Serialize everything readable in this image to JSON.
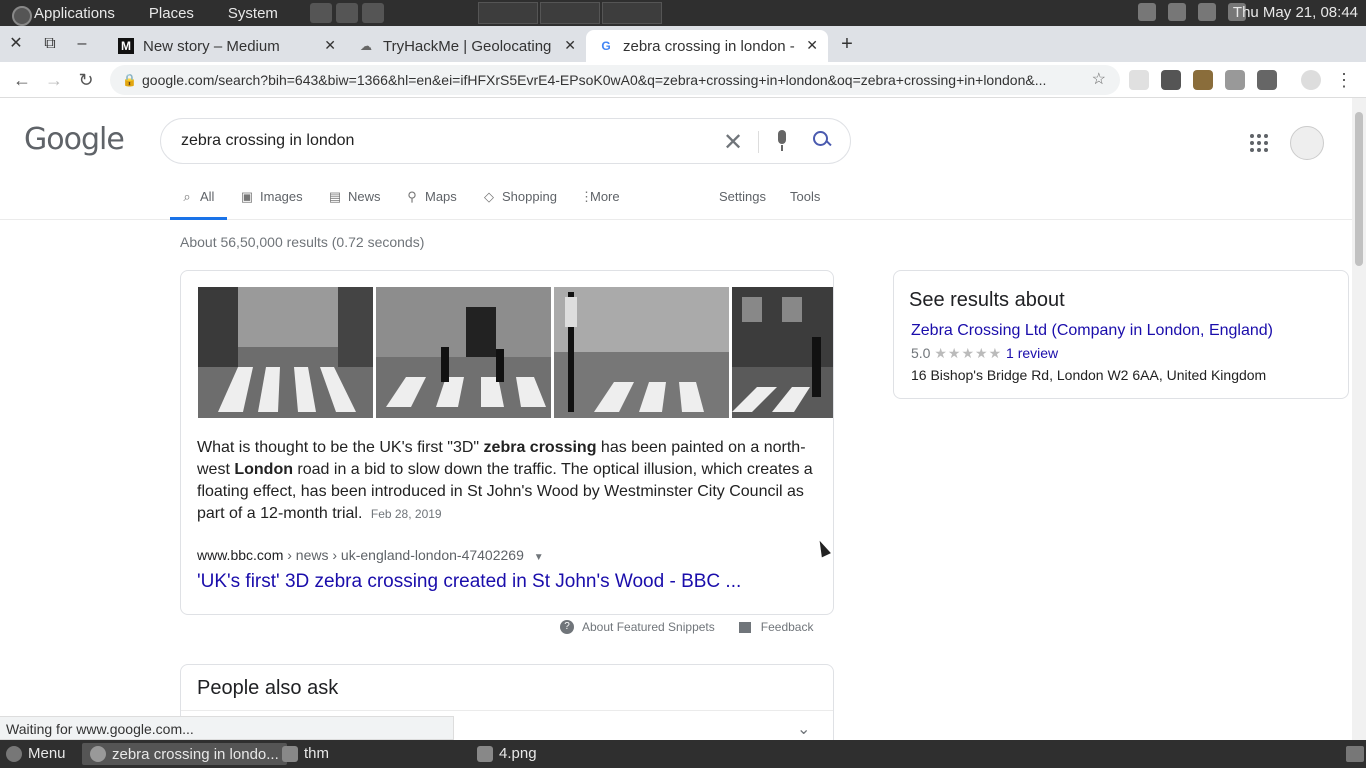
{
  "system_panel": {
    "menus": [
      "Applications",
      "Places",
      "System"
    ],
    "clock": "Thu May 21, 08:44"
  },
  "browser": {
    "tabs": [
      {
        "title": "New story – Medium"
      },
      {
        "title": "TryHackMe | Geolocating"
      },
      {
        "title": "zebra crossing in london -"
      }
    ],
    "new_tab": "+",
    "url": "google.com/search?bih=643&biw=1366&hl=en&ei=ifHFXrS5EvrE4-EPsoK0wA0&q=zebra+crossing+in+london&oq=zebra+crossing+in+london&...",
    "status_text": "Waiting for www.google.com..."
  },
  "google": {
    "logo": "Google",
    "query": "zebra crossing in london",
    "nav_tabs": [
      {
        "label": "All",
        "icon": "search-icon"
      },
      {
        "label": "Images",
        "icon": "image-icon"
      },
      {
        "label": "News",
        "icon": "news-icon"
      },
      {
        "label": "Maps",
        "icon": "map-pin-icon"
      },
      {
        "label": "Shopping",
        "icon": "tag-icon"
      },
      {
        "label": "More",
        "icon": "more-vert-icon"
      }
    ],
    "settings_label": "Settings",
    "tools_label": "Tools",
    "result_stats": "About 56,50,000 results (0.72 seconds)",
    "featured": {
      "snippet_parts": [
        "What is thought to be the UK's first \"3D\" ",
        "zebra crossing",
        " has been painted on a north-west ",
        "London",
        " road in a bid to slow down the traffic. The optical illusion, which creates a floating effect, has been introduced in St John's Wood by Westminster City Council as part of a 12-month trial."
      ],
      "date": "Feb 28, 2019",
      "cite_domain": "www.bbc.com",
      "cite_path": " › news › uk-england-london-47402269",
      "link_title": "'UK's first' 3D zebra crossing created in St John's Wood - BBC ..."
    },
    "about_snippets": "About Featured Snippets",
    "feedback": "Feedback",
    "people_also_ask": "People also ask",
    "knowledge_panel": {
      "title": "See results about",
      "name": "Zebra Crossing Ltd (Company in London, England)",
      "rating": "5.0",
      "stars": "★★★★★",
      "reviews": "1 review",
      "address": "16 Bishop's Bridge Rd, London W2 6AA, United Kingdom"
    }
  },
  "taskbar": {
    "menu": "Menu",
    "items": [
      "zebra crossing in londo...",
      "thm",
      "4.png"
    ]
  }
}
